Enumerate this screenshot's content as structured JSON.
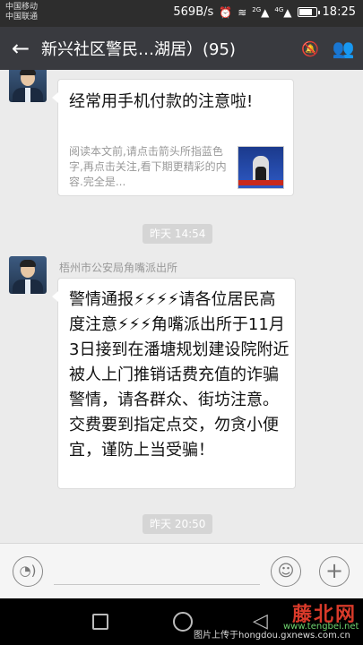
{
  "status_bar": {
    "carrier_1": "中国移动",
    "carrier_2": "中国联通",
    "speed": "569B/s",
    "net_1": "2G",
    "net_2": "4G",
    "time": "18:25"
  },
  "header": {
    "title": "新兴社区警民…湖居）(95)",
    "back_icon": "back-arrow-icon",
    "mute_icon": "mute-bell-icon",
    "members_icon": "group-members-icon"
  },
  "messages": {
    "link_card": {
      "title": "经常用手机付款的注意啦!",
      "description": "阅读本文前,请点击箭头所指蓝色字,再点击关注,看下期更精彩的内容.完全是..."
    },
    "time_1": "昨天 14:54",
    "sender": "梧州市公安局角嘴派出所",
    "text": "警情通报⚡⚡⚡⚡请各位居民高度注意⚡⚡⚡角嘴派出所于11月3日接到在潘塘规划建设院附近被人上门推销话费充值的诈骗警情，请各群众、街坊注意。交费要到指定点交，勿贪小便宜，谨防上当受骗！",
    "time_2": "昨天 20:50"
  },
  "input_bar": {
    "voice_icon": "voice-icon",
    "emoji_icon": "emoji-icon",
    "plus_icon": "plus-icon"
  },
  "watermark": {
    "logo": "藤北网",
    "url": "www.tengbei.net",
    "caption": "图片上传于hongdou.gxnews.com.cn"
  }
}
